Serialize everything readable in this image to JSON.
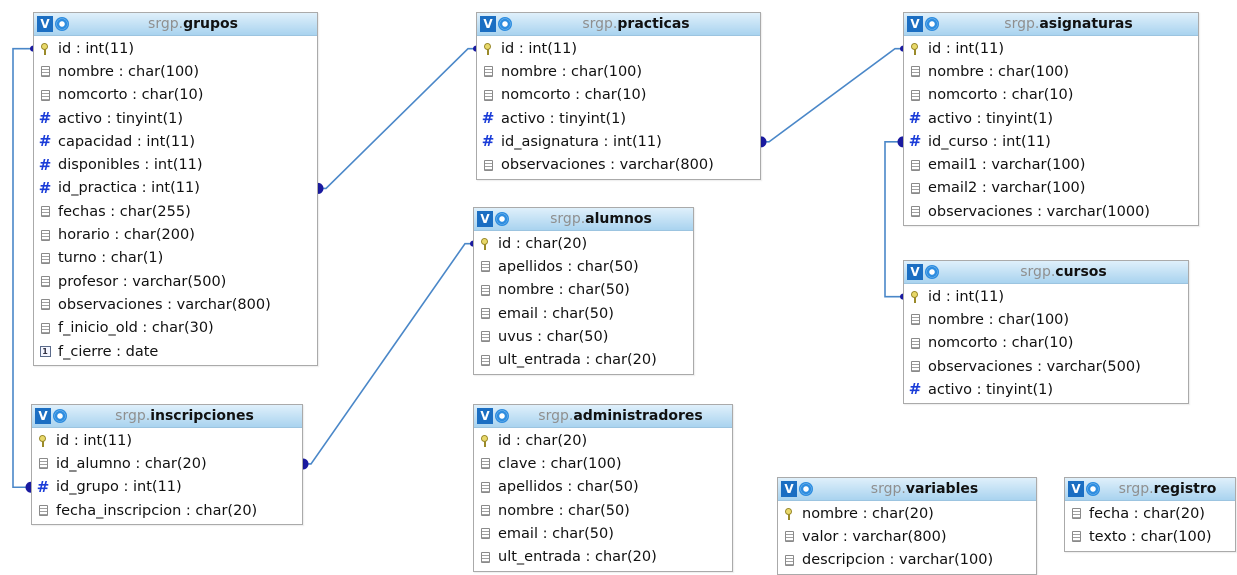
{
  "schema": "srgp.",
  "header_icons": {
    "view": "V",
    "options": "gear-icon"
  },
  "colors": {
    "link": "#4a87c8",
    "endpoint": "#1a1aa0",
    "header_top": "#dff0fb",
    "header_bottom": "#a9d3ef"
  },
  "tables": [
    {
      "id": "grupos",
      "name": "grupos",
      "columns": [
        {
          "label": "id : int(11)",
          "icon": "key"
        },
        {
          "label": "nombre : char(100)",
          "icon": "text"
        },
        {
          "label": "nomcorto : char(10)",
          "icon": "text"
        },
        {
          "label": "activo : tinyint(1)",
          "icon": "number"
        },
        {
          "label": "capacidad : int(11)",
          "icon": "number"
        },
        {
          "label": "disponibles : int(11)",
          "icon": "number"
        },
        {
          "label": "id_practica : int(11)",
          "icon": "number"
        },
        {
          "label": "fechas : char(255)",
          "icon": "text"
        },
        {
          "label": "horario : char(200)",
          "icon": "text"
        },
        {
          "label": "turno : char(1)",
          "icon": "text"
        },
        {
          "label": "profesor : varchar(500)",
          "icon": "text"
        },
        {
          "label": "observaciones : varchar(800)",
          "icon": "text"
        },
        {
          "label": "f_inicio_old : char(30)",
          "icon": "text"
        },
        {
          "label": "f_cierre : date",
          "icon": "date"
        }
      ]
    },
    {
      "id": "practicas",
      "name": "practicas",
      "columns": [
        {
          "label": "id : int(11)",
          "icon": "key"
        },
        {
          "label": "nombre : char(100)",
          "icon": "text"
        },
        {
          "label": "nomcorto : char(10)",
          "icon": "text"
        },
        {
          "label": "activo : tinyint(1)",
          "icon": "number"
        },
        {
          "label": "id_asignatura : int(11)",
          "icon": "number"
        },
        {
          "label": "observaciones : varchar(800)",
          "icon": "text"
        }
      ]
    },
    {
      "id": "asignaturas",
      "name": "asignaturas",
      "columns": [
        {
          "label": "id : int(11)",
          "icon": "key"
        },
        {
          "label": "nombre : char(100)",
          "icon": "text"
        },
        {
          "label": "nomcorto : char(10)",
          "icon": "text"
        },
        {
          "label": "activo : tinyint(1)",
          "icon": "number"
        },
        {
          "label": "id_curso : int(11)",
          "icon": "number"
        },
        {
          "label": "email1 : varchar(100)",
          "icon": "text"
        },
        {
          "label": "email2 : varchar(100)",
          "icon": "text"
        },
        {
          "label": "observaciones : varchar(1000)",
          "icon": "text"
        }
      ]
    },
    {
      "id": "alumnos",
      "name": "alumnos",
      "columns": [
        {
          "label": "id : char(20)",
          "icon": "key"
        },
        {
          "label": "apellidos : char(50)",
          "icon": "text"
        },
        {
          "label": "nombre : char(50)",
          "icon": "text"
        },
        {
          "label": "email : char(50)",
          "icon": "text"
        },
        {
          "label": "uvus : char(50)",
          "icon": "text"
        },
        {
          "label": "ult_entrada : char(20)",
          "icon": "text"
        }
      ]
    },
    {
      "id": "cursos",
      "name": "cursos",
      "columns": [
        {
          "label": "id : int(11)",
          "icon": "key"
        },
        {
          "label": "nombre : char(100)",
          "icon": "text"
        },
        {
          "label": "nomcorto : char(10)",
          "icon": "text"
        },
        {
          "label": "observaciones : varchar(500)",
          "icon": "text"
        },
        {
          "label": "activo : tinyint(1)",
          "icon": "number"
        }
      ]
    },
    {
      "id": "inscripciones",
      "name": "inscripciones",
      "columns": [
        {
          "label": "id : int(11)",
          "icon": "key"
        },
        {
          "label": "id_alumno : char(20)",
          "icon": "text"
        },
        {
          "label": "id_grupo : int(11)",
          "icon": "number"
        },
        {
          "label": "fecha_inscripcion : char(20)",
          "icon": "text"
        }
      ]
    },
    {
      "id": "administradores",
      "name": "administradores",
      "columns": [
        {
          "label": "id : char(20)",
          "icon": "key"
        },
        {
          "label": "clave : char(100)",
          "icon": "text"
        },
        {
          "label": "apellidos : char(50)",
          "icon": "text"
        },
        {
          "label": "nombre : char(50)",
          "icon": "text"
        },
        {
          "label": "email : char(50)",
          "icon": "text"
        },
        {
          "label": "ult_entrada : char(20)",
          "icon": "text"
        }
      ]
    },
    {
      "id": "variables",
      "name": "variables",
      "columns": [
        {
          "label": "nombre : char(20)",
          "icon": "key"
        },
        {
          "label": "valor : varchar(800)",
          "icon": "text"
        },
        {
          "label": "descripcion : varchar(100)",
          "icon": "text"
        }
      ]
    },
    {
      "id": "registro",
      "name": "registro",
      "columns": [
        {
          "label": "fecha : char(20)",
          "icon": "text"
        },
        {
          "label": "texto : char(100)",
          "icon": "text"
        }
      ]
    }
  ],
  "relations": [
    {
      "from": "grupos.id_practica",
      "to": "practicas.id"
    },
    {
      "from": "practicas.id_asignatura",
      "to": "asignaturas.id"
    },
    {
      "from": "asignaturas.id_curso",
      "to": "cursos.id"
    },
    {
      "from": "inscripciones.id_alumno",
      "to": "alumnos.id"
    },
    {
      "from": "inscripciones.id_grupo",
      "to": "grupos.id"
    }
  ]
}
